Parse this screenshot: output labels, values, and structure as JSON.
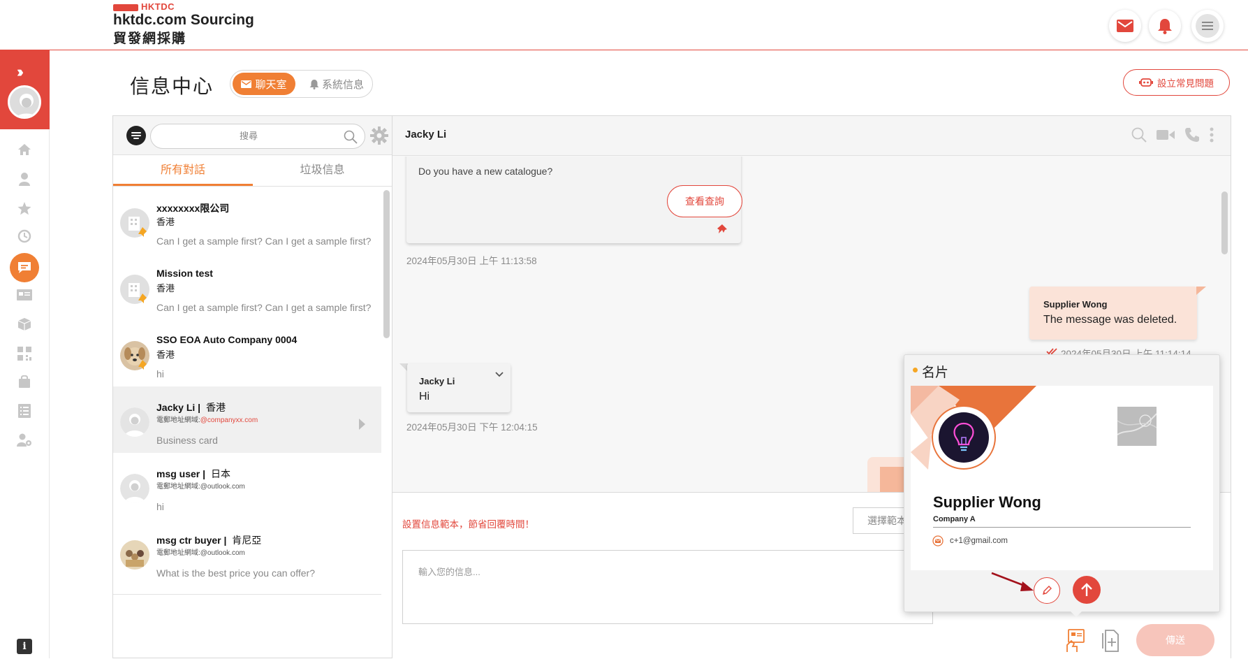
{
  "brand": {
    "tag": "HKTDC",
    "name": "hktdc.com Sourcing",
    "name_zh": "貿發網採購"
  },
  "header": {
    "title": "信息中心",
    "tab_chat": "聊天室",
    "tab_system": "系統信息",
    "faq_button": "設立常見問題"
  },
  "colors": {
    "brand_red": "#e2473c",
    "accent_orange": "#f07f34",
    "out_bubble": "#fbe3d8"
  },
  "list": {
    "search_placeholder": "搜尋",
    "tabs": [
      "所有對話",
      "垃圾信息"
    ],
    "conversations": [
      {
        "name": "xxxxxxxx限公司",
        "location": "香港",
        "message": "Can I get a sample first? Can I get a sample first?"
      },
      {
        "name": "Mission test",
        "location": "香港",
        "message": "Can I get a sample first? Can I get a sample first?"
      },
      {
        "name": "SSO EOA Auto Company 0004",
        "location": "香港",
        "message": "hi"
      },
      {
        "name": "Jacky Li",
        "location": "香港",
        "email_prefix": "電郵地址網域:",
        "email_domain": "@companyxx.com",
        "message": "Business card"
      },
      {
        "name": "msg user",
        "location": "日本",
        "email_prefix": "電郵地址網域:",
        "email_domain": "@outlook.com",
        "message": "hi"
      },
      {
        "name": "msg ctr buyer",
        "location": "肯尼亞",
        "email_prefix": "電郵地址網域:",
        "email_domain": "@outlook.com",
        "message": "What is the best price you can offer?"
      }
    ]
  },
  "chat": {
    "contact": "Jacky Li",
    "messages": [
      {
        "text": "Do you have a new catalogue?",
        "button": "查看查詢",
        "time": "2024年05月30日 上午 11:13:58"
      },
      {
        "sender": "Supplier Wong",
        "text": "The message was deleted.",
        "time": "2024年05月30日 上午 11:14:14"
      },
      {
        "sender": "Jacky Li",
        "text": "Hi",
        "time": "2024年05月30日 下午 12:04:15"
      }
    ],
    "template_hint": "設置信息範本，節省回覆時間！",
    "template_select": "選擇範本",
    "input_placeholder": "輸入您的信息...",
    "send_button": "傳送"
  },
  "business_card": {
    "title": "名片",
    "name": "Supplier Wong",
    "company": "Company A",
    "email": "c+1@gmail.com"
  }
}
